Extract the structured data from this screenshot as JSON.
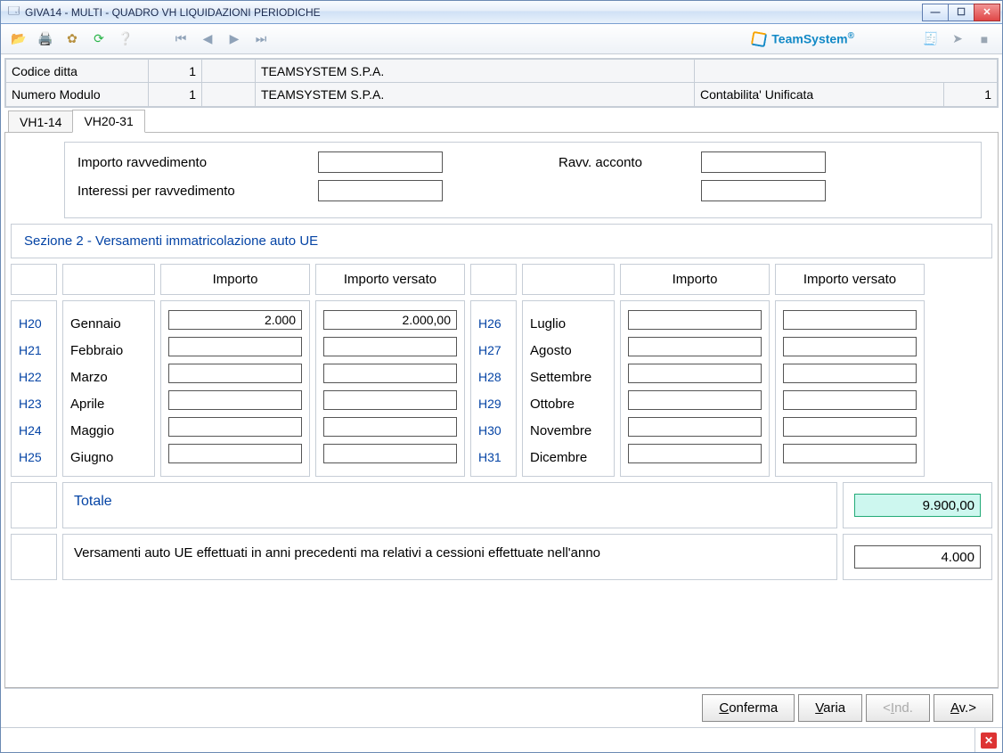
{
  "window": {
    "title": "GIVA14  -  MULTI -   QUADRO VH LIQUIDAZIONI PERIODICHE"
  },
  "brand": {
    "name": "TeamSystem",
    "reg": "®"
  },
  "header": {
    "codice_label": "Codice ditta",
    "codice_value": "1",
    "azienda1": "TEAMSYSTEM S.P.A.",
    "modulo_label": "Numero Modulo",
    "modulo_value": "1",
    "azienda2": "TEAMSYSTEM S.P.A.",
    "contab_label": "Contabilita' Unificata",
    "contab_value": "1"
  },
  "tabs": {
    "t1": "VH1-14",
    "t2": "VH20-31"
  },
  "ravv": {
    "r1_label": "Importo ravvedimento",
    "r2_label": "Interessi per ravvedimento",
    "acconto_label": "Ravv. acconto"
  },
  "section2_title": "Sezione 2 - Versamenti immatricolazione auto UE",
  "columns": {
    "importo": "Importo",
    "versato": "Importo versato"
  },
  "rowsL": [
    {
      "code": "H20",
      "month": "Gennaio",
      "imp": "2.000",
      "ver": "2.000,00"
    },
    {
      "code": "H21",
      "month": "Febbraio",
      "imp": "",
      "ver": ""
    },
    {
      "code": "H22",
      "month": "Marzo",
      "imp": "",
      "ver": ""
    },
    {
      "code": "H23",
      "month": "Aprile",
      "imp": "",
      "ver": ""
    },
    {
      "code": "H24",
      "month": "Maggio",
      "imp": "",
      "ver": ""
    },
    {
      "code": "H25",
      "month": "Giugno",
      "imp": "",
      "ver": ""
    }
  ],
  "rowsR": [
    {
      "code": "H26",
      "month": "Luglio",
      "imp": "",
      "ver": ""
    },
    {
      "code": "H27",
      "month": "Agosto",
      "imp": "",
      "ver": ""
    },
    {
      "code": "H28",
      "month": "Settembre",
      "imp": "",
      "ver": ""
    },
    {
      "code": "H29",
      "month": "Ottobre",
      "imp": "",
      "ver": ""
    },
    {
      "code": "H30",
      "month": "Novembre",
      "imp": "",
      "ver": ""
    },
    {
      "code": "H31",
      "month": "Dicembre",
      "imp": "",
      "ver": ""
    }
  ],
  "totale": {
    "label": "Totale",
    "value": "9.900,00"
  },
  "note": {
    "text": "Versamenti auto UE effettuati in anni precedenti ma relativi a cessioni effettuate nell'anno",
    "value": "4.000"
  },
  "buttons": {
    "conferma": "Conferma",
    "varia": "Varia",
    "ind": "<Ind.",
    "av": "Av.>"
  },
  "confU": "C",
  "variaU": "V",
  "indU": "I",
  "avU": "A",
  "icons": {
    "open": "open-icon",
    "print": "print-icon",
    "settings": "settings-icon",
    "refresh": "refresh-icon",
    "help": "help-icon",
    "first": "first-icon",
    "prev": "prev-icon",
    "next": "next-icon",
    "last": "last-icon",
    "pdf": "pdf-icon",
    "export": "export-icon",
    "stop": "stop-icon"
  }
}
